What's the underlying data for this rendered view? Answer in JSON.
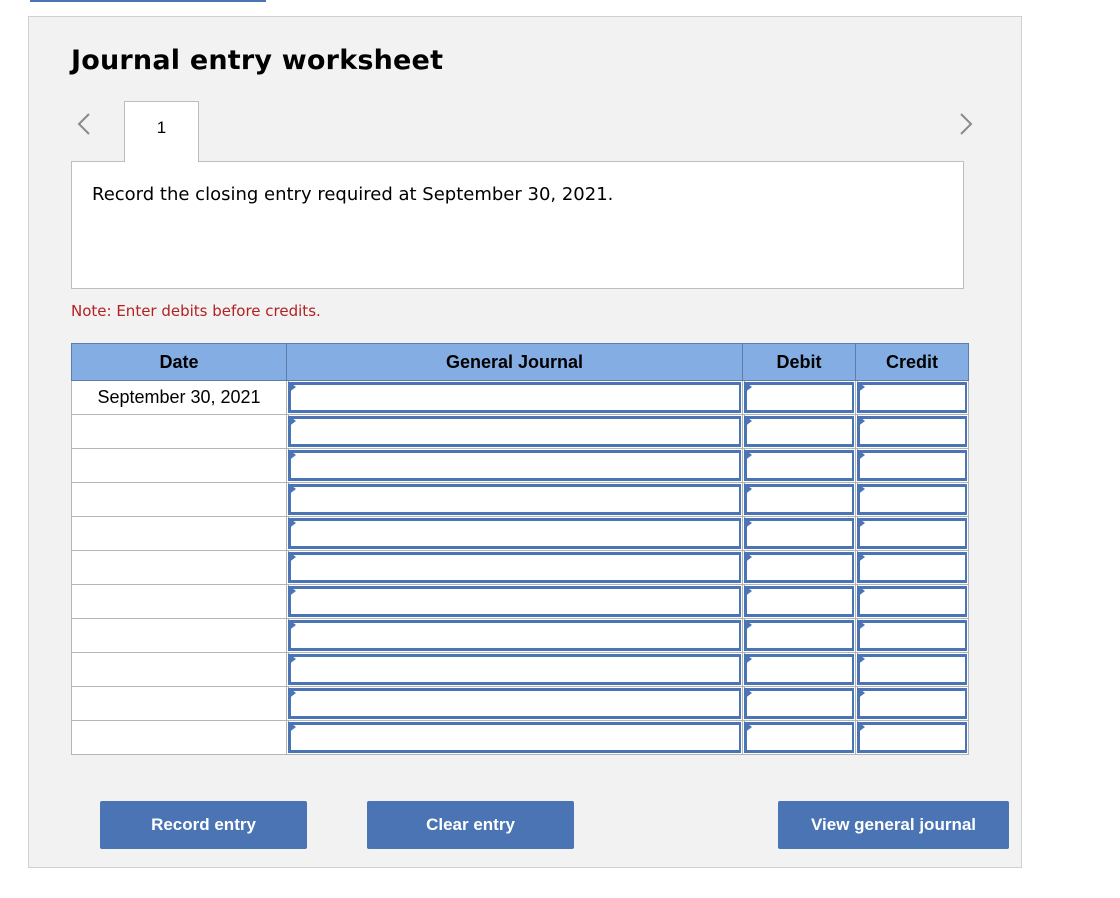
{
  "worksheet": {
    "title": "Journal entry worksheet",
    "tab_label": "1",
    "question": "Record the closing entry required at September 30, 2021.",
    "note": "Note: Enter debits before credits."
  },
  "table": {
    "headers": {
      "date": "Date",
      "journal": "General Journal",
      "debit": "Debit",
      "credit": "Credit"
    },
    "rows": [
      {
        "date": "September 30, 2021",
        "journal": "",
        "debit": "",
        "credit": ""
      },
      {
        "date": "",
        "journal": "",
        "debit": "",
        "credit": ""
      },
      {
        "date": "",
        "journal": "",
        "debit": "",
        "credit": ""
      },
      {
        "date": "",
        "journal": "",
        "debit": "",
        "credit": ""
      },
      {
        "date": "",
        "journal": "",
        "debit": "",
        "credit": ""
      },
      {
        "date": "",
        "journal": "",
        "debit": "",
        "credit": ""
      },
      {
        "date": "",
        "journal": "",
        "debit": "",
        "credit": ""
      },
      {
        "date": "",
        "journal": "",
        "debit": "",
        "credit": ""
      },
      {
        "date": "",
        "journal": "",
        "debit": "",
        "credit": ""
      },
      {
        "date": "",
        "journal": "",
        "debit": "",
        "credit": ""
      },
      {
        "date": "",
        "journal": "",
        "debit": "",
        "credit": ""
      }
    ]
  },
  "buttons": {
    "record": "Record entry",
    "clear": "Clear entry",
    "view": "View general journal"
  },
  "icons": {
    "prev": "chevron-left-icon",
    "next": "chevron-right-icon"
  },
  "colors": {
    "accent": "#4a74b3",
    "header_bg": "#84aee3",
    "note": "#b22222"
  }
}
